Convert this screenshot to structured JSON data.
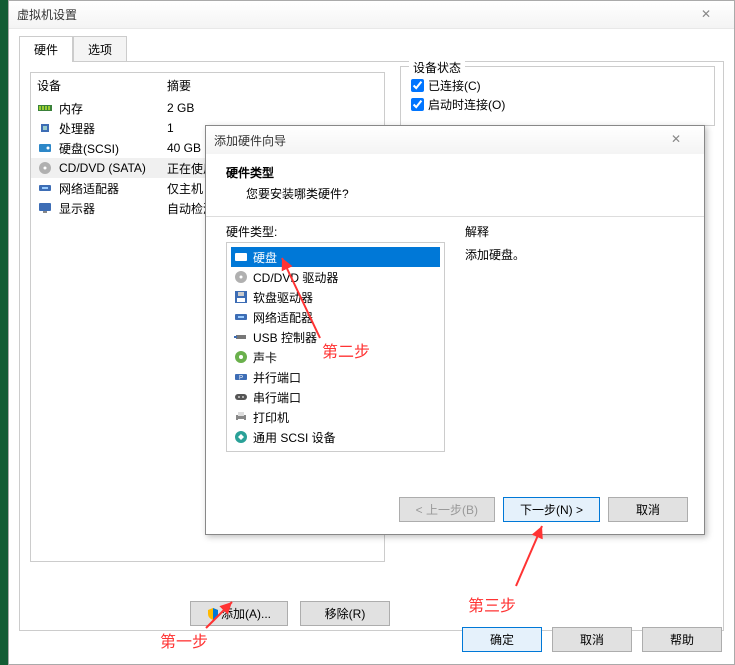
{
  "main": {
    "title": "虚拟机设置",
    "tabs": {
      "hardware": "硬件",
      "options": "选项"
    },
    "headers": {
      "device": "设备",
      "summary": "摘要"
    },
    "devices": [
      {
        "icon": "memory",
        "name": "内存",
        "summary": "2 GB"
      },
      {
        "icon": "cpu",
        "name": "处理器",
        "summary": "1"
      },
      {
        "icon": "disk",
        "name": "硬盘(SCSI)",
        "summary": "40 GB"
      },
      {
        "icon": "cd",
        "name": "CD/DVD (SATA)",
        "summary": "正在使用",
        "selected": true
      },
      {
        "icon": "net",
        "name": "网络适配器",
        "summary": "仅主机"
      },
      {
        "icon": "display",
        "name": "显示器",
        "summary": "自动检测"
      }
    ],
    "add_btn": "添加(A)...",
    "remove_btn": "移除(R)",
    "status": {
      "legend": "设备状态",
      "connected": "已连接(C)",
      "connect_on": "启动时连接(O)"
    },
    "ok": "确定",
    "cancel": "取消",
    "help": "帮助"
  },
  "wizard": {
    "title": "添加硬件向导",
    "heading": "硬件类型",
    "sub": "您要安装哪类硬件?",
    "list_label": "硬件类型:",
    "explain_label": "解释",
    "explain_text": "添加硬盘。",
    "items": [
      {
        "icon": "disk",
        "label": "硬盘",
        "selected": true
      },
      {
        "icon": "cd",
        "label": "CD/DVD 驱动器"
      },
      {
        "icon": "floppy",
        "label": "软盘驱动器"
      },
      {
        "icon": "net",
        "label": "网络适配器"
      },
      {
        "icon": "usb",
        "label": "USB 控制器"
      },
      {
        "icon": "sound",
        "label": "声卡"
      },
      {
        "icon": "parallel",
        "label": "并行端口"
      },
      {
        "icon": "serial",
        "label": "串行端口"
      },
      {
        "icon": "printer",
        "label": "打印机"
      },
      {
        "icon": "scsi",
        "label": "通用 SCSI 设备"
      }
    ],
    "back": "< 上一步(B)",
    "next": "下一步(N) >",
    "cancel": "取消"
  },
  "anno": {
    "step1": "第一步",
    "step2": "第二步",
    "step3": "第三步"
  }
}
